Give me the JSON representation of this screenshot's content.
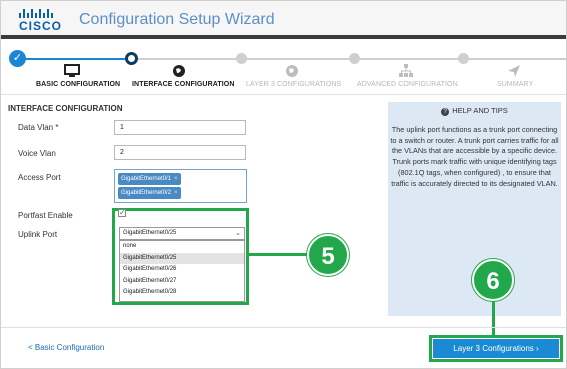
{
  "header": {
    "logo_text": "CISCO",
    "title": "Configuration Setup Wizard"
  },
  "steps": [
    {
      "label": "BASIC CONFIGURATION",
      "state": "done",
      "icon": "monitor-icon"
    },
    {
      "label": "INTERFACE CONFIGURATION",
      "state": "active",
      "icon": "globe-icon"
    },
    {
      "label": "LAYER 3 CONFIGURATIONS",
      "state": "pending",
      "icon": "globe-icon"
    },
    {
      "label": "ADVANCED CONFIGURATION",
      "state": "pending",
      "icon": "network-icon"
    },
    {
      "label": "SUMMARY",
      "state": "pending",
      "icon": "send-icon"
    }
  ],
  "form": {
    "section_title": "INTERFACE CONFIGURATION",
    "data_vlan": {
      "label": "Data Vlan *",
      "value": "1"
    },
    "voice_vlan": {
      "label": "Voice Vlan",
      "value": "2"
    },
    "access_port": {
      "label": "Access Port",
      "tags": [
        "GigabitEthernet0/1",
        "GigabitEthernet0/2"
      ]
    },
    "portfast": {
      "label": "Portfast Enable",
      "checked": true
    },
    "uplink_port": {
      "label": "Uplink Port",
      "value": "GigabitEthernet0/25",
      "options": [
        "none",
        "GigabitEthernet0/25",
        "GigabitEthernet0/26",
        "GigabitEthernet0/27",
        "GigabitEthernet0/28"
      ]
    }
  },
  "help": {
    "title": "HELP AND TIPS",
    "body": "The uplink port functions as a trunk port connecting to a switch or router. A trunk port carries traffic for all the VLANs that are accessible by a specific device. Trunk ports mark traffic with unique identifying tags (802.1Q tags, when configured) , to ensure that traffic is accurately directed to its designated VLAN."
  },
  "callouts": {
    "five": "5",
    "six": "6"
  },
  "footer": {
    "back_label": "< Basic Configuration",
    "next_label": "Layer 3 Configurations ›"
  },
  "colors": {
    "accent": "#1a8ad4",
    "callout": "#22a84a",
    "help_bg": "#dce9f4",
    "header_bar": "#3b3b3b"
  }
}
